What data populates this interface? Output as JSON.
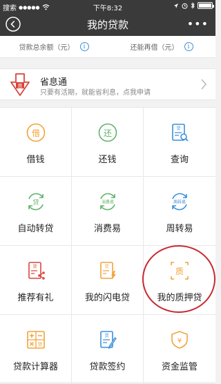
{
  "status_bar": {
    "carrier": "搜索",
    "signal_dots": "●●●●●",
    "time": "下午8:32",
    "battery_level": 0.9
  },
  "nav": {
    "title": "我的贷款",
    "more": "•••"
  },
  "summary": {
    "left_label": "贷款总余额（元）",
    "right_label": "还能再借（元）",
    "info_glyph": "i"
  },
  "promo": {
    "icon_text": "息",
    "title": "省息通",
    "subtitle": "只要有活期，就能省利息，点我申请"
  },
  "grid": {
    "items": [
      {
        "label": "借钱",
        "icon": "borrow-icon",
        "glyph": "借"
      },
      {
        "label": "还钱",
        "icon": "repay-icon",
        "glyph": "还"
      },
      {
        "label": "查询",
        "icon": "query-icon",
        "glyph": "贷"
      },
      {
        "label": "自动转贷",
        "icon": "auto-reloan-icon",
        "glyph": "贷"
      },
      {
        "label": "消费易",
        "icon": "consumer-easy-icon",
        "glyph": "消费易"
      },
      {
        "label": "周转易",
        "icon": "turnover-easy-icon",
        "glyph": "周转易"
      },
      {
        "label": "推荐有礼",
        "icon": "referral-icon",
        "glyph": "贷"
      },
      {
        "label": "我的闪电贷",
        "icon": "flash-loan-icon",
        "glyph": "贷"
      },
      {
        "label": "我的质押贷",
        "icon": "pledge-loan-icon",
        "glyph": "质"
      },
      {
        "label": "贷款计算器",
        "icon": "calculator-icon",
        "glyph": "贷"
      },
      {
        "label": "贷款签约",
        "icon": "contract-icon",
        "glyph": "贷"
      },
      {
        "label": "资金监管",
        "icon": "fund-supervision-icon",
        "glyph": "¥"
      }
    ]
  },
  "colors": {
    "header": "#3a3a3a",
    "orange": "#f0a33a",
    "green": "#5fb36a",
    "blue": "#3b8fd8",
    "red": "#d7463c",
    "highlight": "#c6282f"
  }
}
